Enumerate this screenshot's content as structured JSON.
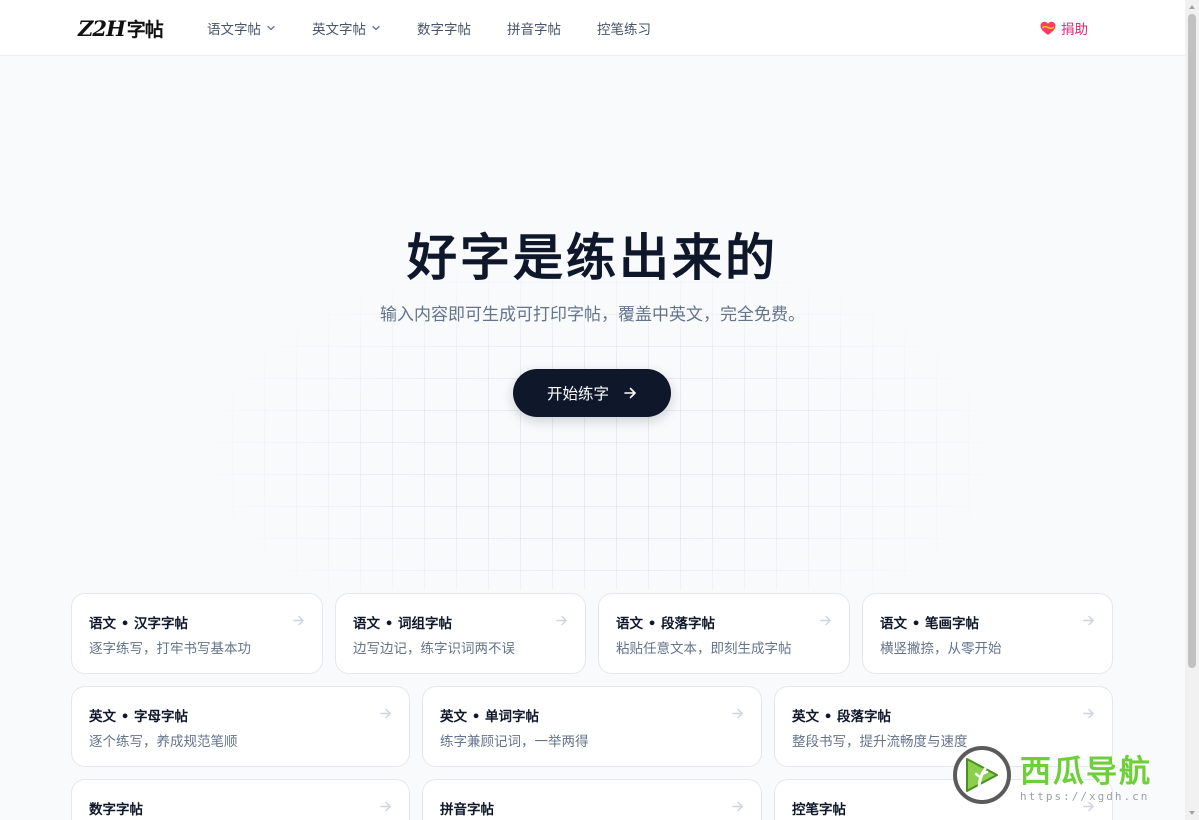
{
  "header": {
    "logo_latin": "Z2H",
    "logo_cn": "字帖",
    "nav": [
      {
        "label": "语文字帖",
        "dropdown": true
      },
      {
        "label": "英文字帖",
        "dropdown": true
      },
      {
        "label": "数字字帖",
        "dropdown": false
      },
      {
        "label": "拼音字帖",
        "dropdown": false
      },
      {
        "label": "控笔练习",
        "dropdown": false
      }
    ],
    "donate_label": "捐助"
  },
  "hero": {
    "title": "好字是练出来的",
    "subtitle": "输入内容即可生成可打印字帖，覆盖中英文，完全免费。",
    "cta_label": "开始练字"
  },
  "cards": [
    {
      "title": "语文 • 汉字字帖",
      "desc": "逐字练写，打牢书写基本功"
    },
    {
      "title": "语文 • 词组字帖",
      "desc": "边写边记，练字识词两不误"
    },
    {
      "title": "语文 • 段落字帖",
      "desc": "粘贴任意文本，即刻生成字帖"
    },
    {
      "title": "语文 • 笔画字帖",
      "desc": "横竖撇捺，从零开始"
    },
    {
      "title": "英文 • 字母字帖",
      "desc": "逐个练写，养成规范笔顺"
    },
    {
      "title": "英文 • 单词字帖",
      "desc": "练字兼顾记词，一举两得"
    },
    {
      "title": "英文 • 段落字帖",
      "desc": "整段书写，提升流畅度与速度"
    },
    {
      "title": "数字字帖",
      "desc": ""
    },
    {
      "title": "拼音字帖",
      "desc": ""
    },
    {
      "title": "控笔字帖",
      "desc": ""
    }
  ],
  "watermark": {
    "brand": "西瓜导航",
    "url": "https://xgdh.cn"
  },
  "colors": {
    "primary": "#0f172a",
    "muted_text": "#64748b",
    "donate": "#db2777",
    "background": "#f8fafc",
    "watermark_green": "#6fcf3a"
  },
  "icons": {
    "nav_dropdown": "chevron-down-icon",
    "donate": "heart-icon",
    "cta": "arrow-right-icon",
    "card": "arrow-right-icon"
  }
}
